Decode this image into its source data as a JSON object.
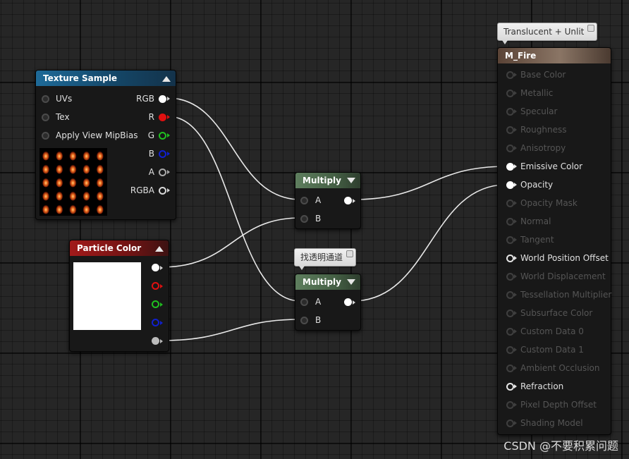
{
  "nodes": {
    "texture_sample": {
      "title": "Texture Sample",
      "inputs": [
        "UVs",
        "Tex",
        "Apply View MipBias"
      ],
      "outputs": [
        "RGB",
        "R",
        "G",
        "B",
        "A",
        "RGBA"
      ]
    },
    "particle_color": {
      "title": "Particle Color"
    },
    "multiply_1": {
      "title": "Multiply",
      "inputs": [
        "A",
        "B"
      ]
    },
    "multiply_2": {
      "title": "Multiply",
      "inputs": [
        "A",
        "B"
      ],
      "comment": "找透明通道"
    },
    "material": {
      "title": "M_Fire",
      "comment": "Translucent + Unlit",
      "pins": [
        {
          "label": "Base Color",
          "active": false
        },
        {
          "label": "Metallic",
          "active": false
        },
        {
          "label": "Specular",
          "active": false
        },
        {
          "label": "Roughness",
          "active": false
        },
        {
          "label": "Anisotropy",
          "active": false
        },
        {
          "label": "Emissive Color",
          "active": true
        },
        {
          "label": "Opacity",
          "active": true
        },
        {
          "label": "Opacity Mask",
          "active": false
        },
        {
          "label": "Normal",
          "active": false
        },
        {
          "label": "Tangent",
          "active": false
        },
        {
          "label": "World Position Offset",
          "active": true
        },
        {
          "label": "World Displacement",
          "active": false
        },
        {
          "label": "Tessellation Multiplier",
          "active": false
        },
        {
          "label": "Subsurface Color",
          "active": false
        },
        {
          "label": "Custom Data 0",
          "active": false
        },
        {
          "label": "Custom Data 1",
          "active": false
        },
        {
          "label": "Ambient Occlusion",
          "active": false
        },
        {
          "label": "Refraction",
          "active": true
        },
        {
          "label": "Pixel Depth Offset",
          "active": false
        },
        {
          "label": "Shading Model",
          "active": false
        }
      ]
    }
  },
  "colors": {
    "pin_r": "#e01010",
    "pin_g": "#20c020",
    "pin_b": "#1020d0",
    "wire": "#e8e8e8"
  },
  "watermark": "CSDN @不要积累问题"
}
